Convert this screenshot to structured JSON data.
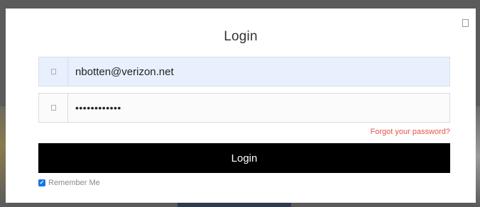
{
  "modal": {
    "title": "Login",
    "email": {
      "value": "nbotten@verizon.net",
      "icon": "envelope-icon"
    },
    "password": {
      "value": "••••••••••••",
      "icon": "lock-icon"
    },
    "forgot_label": "Forgot your password?",
    "login_label": "Login",
    "remember": {
      "label": "Remember Me",
      "checked": true,
      "check_glyph": "✓"
    },
    "close_icon": "close-icon"
  },
  "colors": {
    "button": "#000000",
    "link": "#e5534b",
    "checkbox": "#1a73e8",
    "autofill": "#e8f0fe"
  }
}
